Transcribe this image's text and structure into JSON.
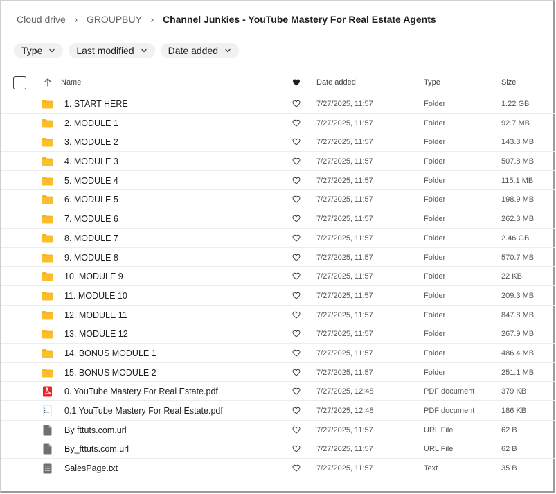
{
  "breadcrumb": {
    "items": [
      "Cloud drive",
      "GROUPBUY",
      "Channel Junkies - YouTube Mastery For Real Estate Agents"
    ]
  },
  "filters": [
    "Type",
    "Last modified",
    "Date added"
  ],
  "table": {
    "columns": {
      "name": "Name",
      "date": "Date added",
      "type": "Type",
      "size": "Size"
    },
    "rows": [
      {
        "icon": "folder-icon",
        "name": "1. START HERE",
        "date": "7/27/2025, 11:57",
        "type": "Folder",
        "size": "1.22 GB"
      },
      {
        "icon": "folder-icon",
        "name": "2. MODULE 1",
        "date": "7/27/2025, 11:57",
        "type": "Folder",
        "size": "92.7 MB"
      },
      {
        "icon": "folder-icon",
        "name": "3. MODULE 2",
        "date": "7/27/2025, 11:57",
        "type": "Folder",
        "size": "143.3 MB"
      },
      {
        "icon": "folder-icon",
        "name": "4. MODULE 3",
        "date": "7/27/2025, 11:57",
        "type": "Folder",
        "size": "507.8 MB"
      },
      {
        "icon": "folder-icon",
        "name": "5. MODULE 4",
        "date": "7/27/2025, 11:57",
        "type": "Folder",
        "size": "115.1 MB"
      },
      {
        "icon": "folder-icon",
        "name": "6. MODULE 5",
        "date": "7/27/2025, 11:57",
        "type": "Folder",
        "size": "198.9 MB"
      },
      {
        "icon": "folder-icon",
        "name": "7. MODULE 6",
        "date": "7/27/2025, 11:57",
        "type": "Folder",
        "size": "262.3 MB"
      },
      {
        "icon": "folder-icon",
        "name": "8. MODULE 7",
        "date": "7/27/2025, 11:57",
        "type": "Folder",
        "size": "2.46 GB"
      },
      {
        "icon": "folder-icon",
        "name": "9. MODULE 8",
        "date": "7/27/2025, 11:57",
        "type": "Folder",
        "size": "570.7 MB"
      },
      {
        "icon": "folder-icon",
        "name": "10. MODULE 9",
        "date": "7/27/2025, 11:57",
        "type": "Folder",
        "size": "22 KB"
      },
      {
        "icon": "folder-icon",
        "name": "11. MODULE 10",
        "date": "7/27/2025, 11:57",
        "type": "Folder",
        "size": "209.3 MB"
      },
      {
        "icon": "folder-icon",
        "name": "12. MODULE 11",
        "date": "7/27/2025, 11:57",
        "type": "Folder",
        "size": "847.8 MB"
      },
      {
        "icon": "folder-icon",
        "name": "13. MODULE 12",
        "date": "7/27/2025, 11:57",
        "type": "Folder",
        "size": "267.9 MB"
      },
      {
        "icon": "folder-icon",
        "name": "14. BONUS MODULE 1",
        "date": "7/27/2025, 11:57",
        "type": "Folder",
        "size": "486.4 MB"
      },
      {
        "icon": "folder-icon",
        "name": "15. BONUS MODULE 2",
        "date": "7/27/2025, 11:57",
        "type": "Folder",
        "size": "251.1 MB"
      },
      {
        "icon": "pdf-icon",
        "name": "0. YouTube Mastery For Real Estate.pdf",
        "date": "7/27/2025, 12:48",
        "type": "PDF document",
        "size": "379 KB"
      },
      {
        "icon": "pdf-thumbnail-icon",
        "name": "0.1 YouTube Mastery For Real Estate.pdf",
        "date": "7/27/2025, 12:48",
        "type": "PDF document",
        "size": "186 KB"
      },
      {
        "icon": "file-icon",
        "name": "By fttuts.com.url",
        "date": "7/27/2025, 11:57",
        "type": "URL File",
        "size": "62 B"
      },
      {
        "icon": "file-icon",
        "name": "By_fttuts.com.url",
        "date": "7/27/2025, 11:57",
        "type": "URL File",
        "size": "62 B"
      },
      {
        "icon": "text-file-icon",
        "name": "SalesPage.txt",
        "date": "7/27/2025, 11:57",
        "type": "Text",
        "size": "35 B"
      }
    ]
  },
  "colors": {
    "folder": "#f9b31c",
    "pdf": "#e5252a",
    "file": "#6f6f6f",
    "chip_bg": "#f0f1f3"
  }
}
